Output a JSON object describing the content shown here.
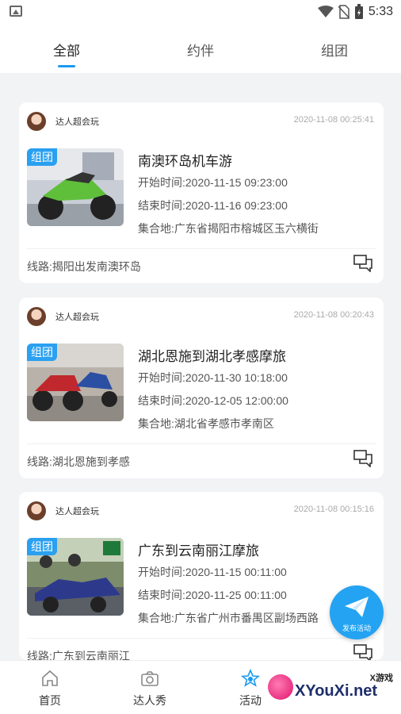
{
  "status_bar": {
    "time": "5:33"
  },
  "tabs": [
    {
      "label": "全部",
      "active": true
    },
    {
      "label": "约伴",
      "active": false
    },
    {
      "label": "组团",
      "active": false
    }
  ],
  "cards": [
    {
      "author": "达人超会玩",
      "posted": "2020-11-08 00:25:41",
      "badge": "组团",
      "title": "南澳环岛机车游",
      "start": "开始时间:2020-11-15 09:23:00",
      "end": "结束时间:2020-11-16 09:23:00",
      "meet": "集合地:广东省揭阳市榕城区玉六横街",
      "route": "线路:揭阳出发南澳环岛"
    },
    {
      "author": "达人超会玩",
      "posted": "2020-11-08 00:20:43",
      "badge": "组团",
      "title": "湖北恩施到湖北孝感摩旅",
      "start": "开始时间:2020-11-30 10:18:00",
      "end": "结束时间:2020-12-05 12:00:00",
      "meet": "集合地:湖北省孝感市孝南区",
      "route": "线路:湖北恩施到孝感"
    },
    {
      "author": "达人超会玩",
      "posted": "2020-11-08 00:15:16",
      "badge": "组团",
      "title": "广东到云南丽江摩旅",
      "start": "开始时间:2020-11-15 00:11:00",
      "end": "结束时间:2020-11-25 00:11:00",
      "meet": "集合地:广东省广州市番禺区副场西路",
      "route": "线路:广东到云南丽江"
    }
  ],
  "fab": {
    "label": "发布活动"
  },
  "bottom_nav": [
    {
      "label": "首页",
      "icon": "home-icon"
    },
    {
      "label": "达人秀",
      "icon": "camera-icon"
    },
    {
      "label": "活动",
      "icon": "activity-icon"
    }
  ],
  "watermark": {
    "main": "XYouXi.net",
    "sub": "X游戏"
  },
  "colors": {
    "accent": "#1a9bf0",
    "badge": "#2aa0f0",
    "background": "#f2f3f5"
  }
}
